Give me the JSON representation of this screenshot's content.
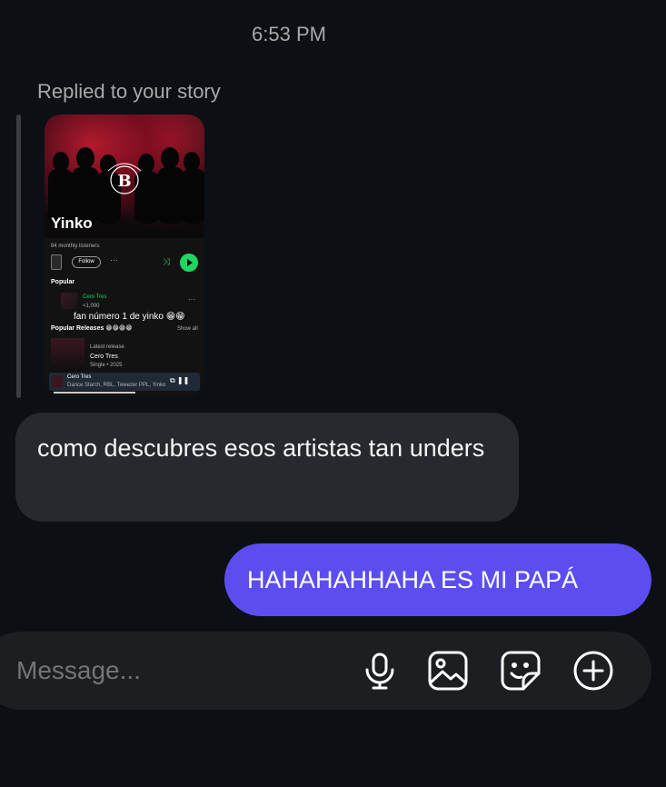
{
  "timestamp": "6:53 PM",
  "reply_label": "Replied to your story",
  "story": {
    "artist_name": "Yinko",
    "monthly_listeners": "84 monthly listeners",
    "follow_label": "Follow",
    "popular_title": "Popular",
    "track_name": "Cero Tres",
    "track_meta": "<1,000",
    "overlay_text": "fan número 1 de yinko 😁😁",
    "popular_releases_title": "Popular Releases 😁😁😁😁",
    "show_all": "Show all",
    "latest_release": "Latest release",
    "release_name": "Cero Tres",
    "release_meta": "Single • 2025",
    "player_title": "Cero Tres",
    "player_artists": "Dance Starch, RBL, Tweezer PPL, Yinko"
  },
  "messages": {
    "incoming_text": "como descubres  esos artistas tan unders",
    "outgoing_text": "HAHAHAHHAHA ES MI PAPÁ"
  },
  "composer": {
    "placeholder": "Message...",
    "icons": [
      "microphone-icon",
      "image-icon",
      "sticker-icon",
      "plus-icon"
    ]
  },
  "colors": {
    "background": "#0c1014",
    "incoming_bubble": "#26292e",
    "outgoing_bubble": "#5b4df0",
    "spotify_green": "#1ed760"
  }
}
